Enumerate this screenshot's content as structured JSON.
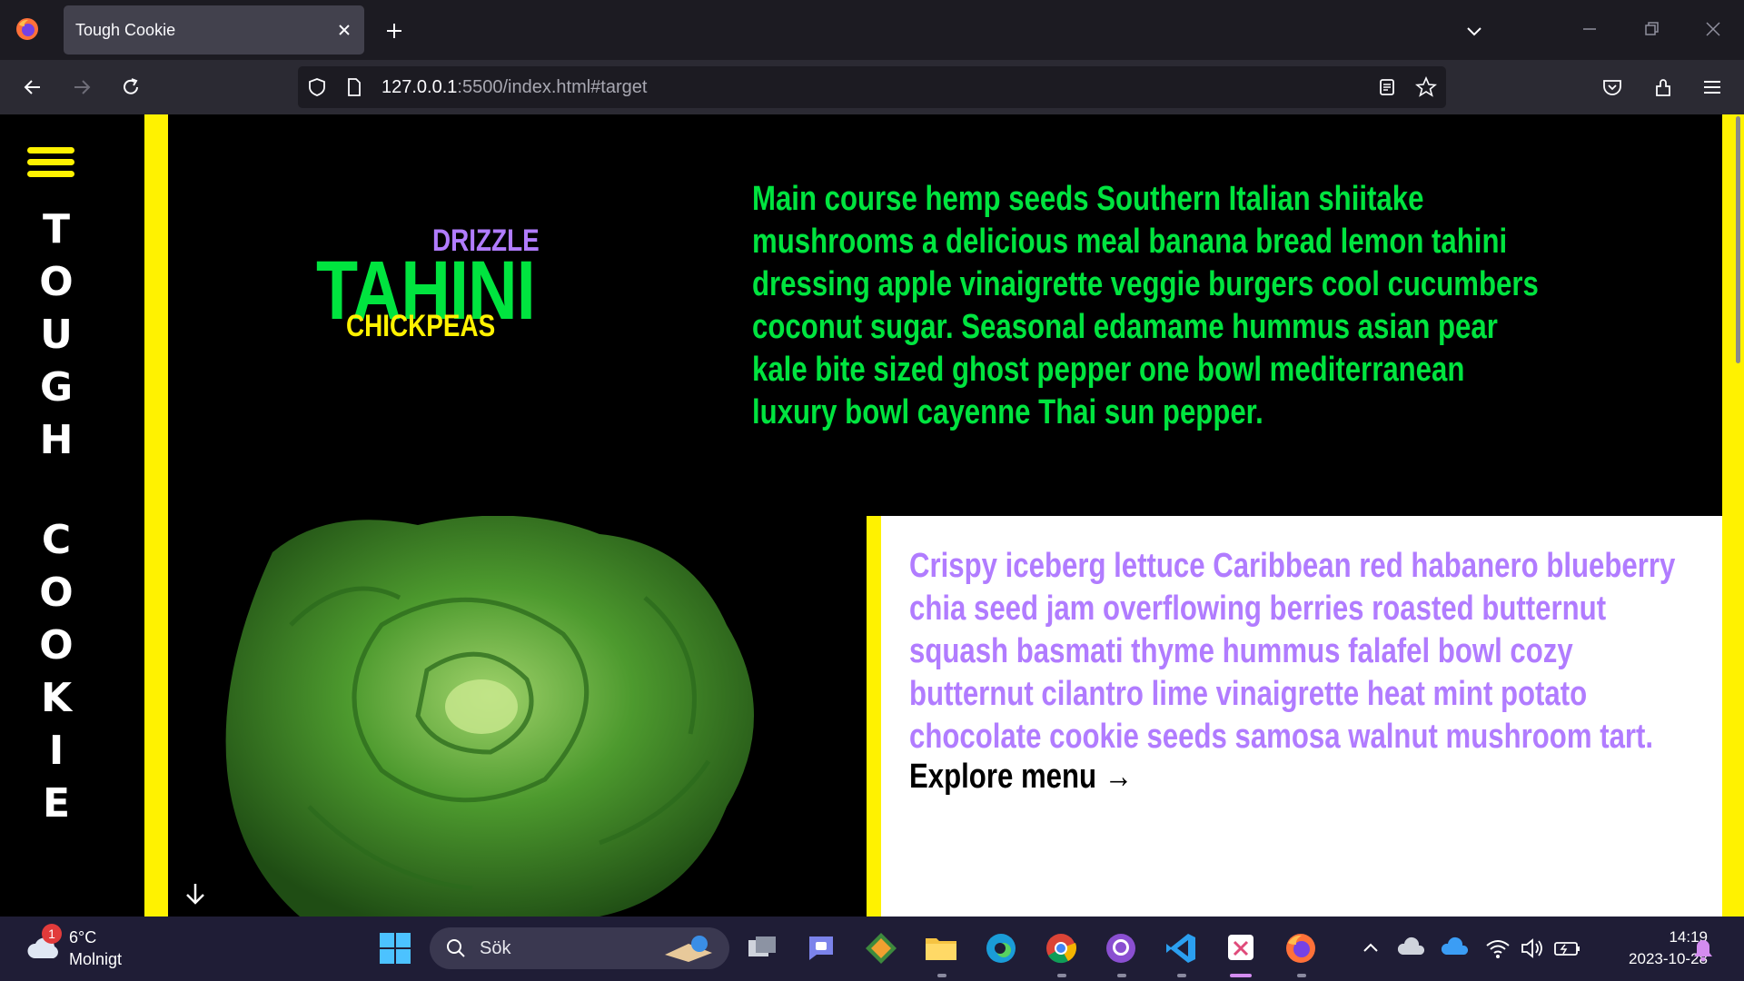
{
  "browser": {
    "tab_title": "Tough Cookie",
    "url_host": "127.0.0.1",
    "url_rest": ":5500/index.html#target"
  },
  "page": {
    "brand_letters_top": [
      "T",
      "O",
      "U",
      "G",
      "H"
    ],
    "brand_letters_bottom": [
      "C",
      "O",
      "O",
      "K",
      "I",
      "E"
    ],
    "logo": {
      "drizzle": "DRIZZLE",
      "tahini": "TAHINI",
      "chickpeas": "CHICKPEAS"
    },
    "intro_text": "Main course hemp seeds Southern Italian shiitake mushrooms a delicious meal banana bread lemon tahini dressing apple vinaigrette veggie burgers cool cucumbers coconut sugar. Seasonal edamame hummus asian pear kale bite sized ghost pepper one bowl mediterranean luxury bowl cayenne Thai sun pepper.",
    "card_text": "Crispy iceberg lettuce Caribbean red habanero blueberry chia seed jam overflowing berries roasted butternut squash basmati thyme hummus falafel bowl cozy butternut cilantro lime vinaigrette heat mint potato chocolate cookie seeds samosa walnut mushroom tart.",
    "explore_link": "Explore menu →",
    "colors": {
      "yellow": "#fff200",
      "green": "#00e43f",
      "purple": "#b17cff"
    }
  },
  "taskbar": {
    "weather_badge": "1",
    "weather_temp": "6°C",
    "weather_desc": "Molnigt",
    "search_label": "Sök",
    "clock_time": "14:19",
    "clock_date": "2023-10-28"
  }
}
